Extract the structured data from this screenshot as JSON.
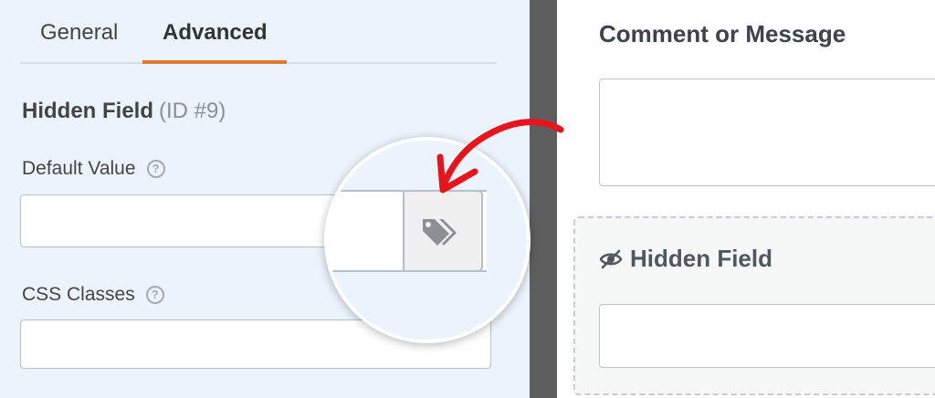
{
  "tabs": [
    {
      "label": "General",
      "active": false
    },
    {
      "label": "Advanced",
      "active": true
    }
  ],
  "field": {
    "title": "Hidden Field",
    "id_text": "(ID #9)"
  },
  "default_value": {
    "label": "Default Value",
    "help_glyph": "?",
    "value": "",
    "smart_tag_icon": "tag-icon"
  },
  "css_classes": {
    "label": "CSS Classes",
    "help_glyph": "?",
    "value": ""
  },
  "preview": {
    "comment_title": "Comment or Message",
    "hidden_field_label": "Hidden Field",
    "hidden_icon": "eye-slash-icon"
  },
  "colors": {
    "accent": "#e27730",
    "arrow": "#e8141c",
    "panel_bg": "#ebf3fc",
    "divider": "#5e5e5e"
  }
}
